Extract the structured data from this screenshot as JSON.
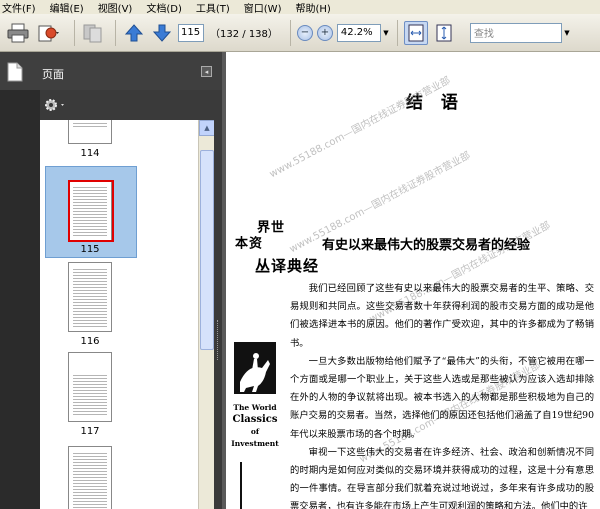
{
  "menu": [
    "文件(F)",
    "编辑(E)",
    "视图(V)",
    "文档(D)",
    "工具(T)",
    "窗口(W)",
    "帮助(H)"
  ],
  "toolbar": {
    "current_page": "115",
    "page_count": "（132 / 138）",
    "zoom": "42.2%",
    "search_placeholder": "查找"
  },
  "panel": {
    "title": "页面",
    "thumbnails": [
      {
        "label": "114"
      },
      {
        "label": "115",
        "selected": true
      },
      {
        "label": "116"
      },
      {
        "label": "117"
      }
    ]
  },
  "document": {
    "title": "结  语",
    "section_title": "有史以来最伟大的股票交易者的经验",
    "side_brand_cn": [
      "世界",
      "资本",
      "经典译丛"
    ],
    "side_brand_en": [
      "The World",
      "Classics",
      "of Investment"
    ],
    "watermark": "www.55188.com—国内在线证券股市营业部",
    "paragraphs": [
      "我们已经回顾了这些有史以来最伟大的股票交易者的生平、策略、交易规则和共同点。这些交易者数十年获得利润的股市交易方面的成功是他们被选择进本书的原因。他们的著作广受欢迎，其中的许多都成为了畅销书。",
      "一旦大多数出版物给他们赋予了“最伟大”的头衔，不管它被用在哪一个方面或是哪一个职业上，关于这些人选或是那些被认为应该入选却排除在外的人物的争议就将出现。被本书选入的人物都是那些积极地为自己的账户交易的交易者。当然，选择他们的原因还包括他们涵盖了自19世纪90年代以来股票市场的各个时期。",
      "审视一下这些伟大的交易者在许多经济、社会、政治和创新情况不同的时期内是如何应对类似的交易环境并获得成功的过程，这是十分有意思的一件事情。在导言部分我们就着充说过地说过，多年来有许多成功的股票交易者，也有许多能在市场上产生可观利润的策略和方法。他们中的许"
    ]
  },
  "colors": {
    "menubar": "#ece9d8",
    "panel_dark": "#2b2b2b",
    "selection": "#a6c8ea",
    "page_frame": "#e00000"
  }
}
